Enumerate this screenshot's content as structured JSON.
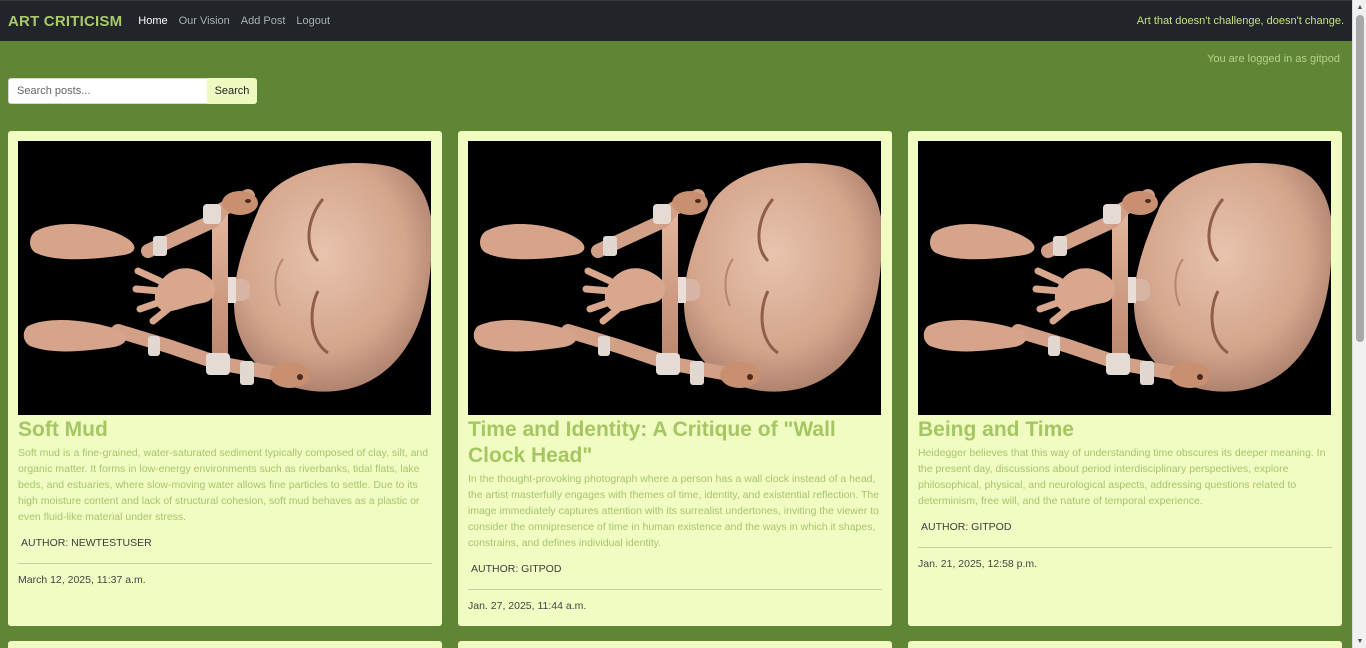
{
  "navbar": {
    "brand": "ART CRITICISM",
    "links": [
      {
        "label": "Home"
      },
      {
        "label": "Our Vision"
      },
      {
        "label": "Add Post"
      },
      {
        "label": "Logout"
      }
    ],
    "tagline": "Art that doesn't challenge, doesn't change."
  },
  "login_status": "You are logged in as gitpod",
  "search": {
    "placeholder": "Search posts...",
    "value": "",
    "button_label": "Search"
  },
  "posts": [
    {
      "title": "Soft Mud",
      "excerpt": "Soft mud is a fine-grained, water-saturated sediment typically composed of clay, silt, and organic matter. It forms in low-energy environments such as riverbanks, tidal flats, lake beds, and estuaries, where slow-moving water allows fine particles to settle. Due to its high moisture content and lack of structural cohesion, soft mud behaves as a plastic or even fluid-like material under stress.",
      "author": "AUTHOR: NEWTESTUSER",
      "date": "March 12, 2025, 11:37 a.m."
    },
    {
      "title": "Time and Identity: A Critique of \"Wall Clock Head\"",
      "excerpt": "In the thought-provoking photograph where a person has a wall clock instead of a head, the artist masterfully engages with themes of time, identity, and existential reflection. The image immediately captures attention with its surrealist undertones, inviting the viewer to consider the omnipresence of time in human existence and the ways in which it shapes, constrains, and defines individual identity.",
      "author": "AUTHOR: GITPOD",
      "date": "Jan. 27, 2025, 11:44 a.m."
    },
    {
      "title": "Being and Time",
      "excerpt": "Heidegger believes that this way of understanding time obscures its deeper meaning. In the present day, discussions about period interdisciplinary perspectives, explore philosophical, physical, and neurological aspects, addressing questions related to determinism, free will, and the nature of temporal experience.",
      "author": "AUTHOR: GITPOD",
      "date": "Jan. 21, 2025, 12:58 p.m."
    }
  ],
  "colors": {
    "background": "#5f8634",
    "navbar": "#212428",
    "card": "#f0fcc2",
    "title": "#a5c661",
    "tagline": "#c6e07f"
  }
}
